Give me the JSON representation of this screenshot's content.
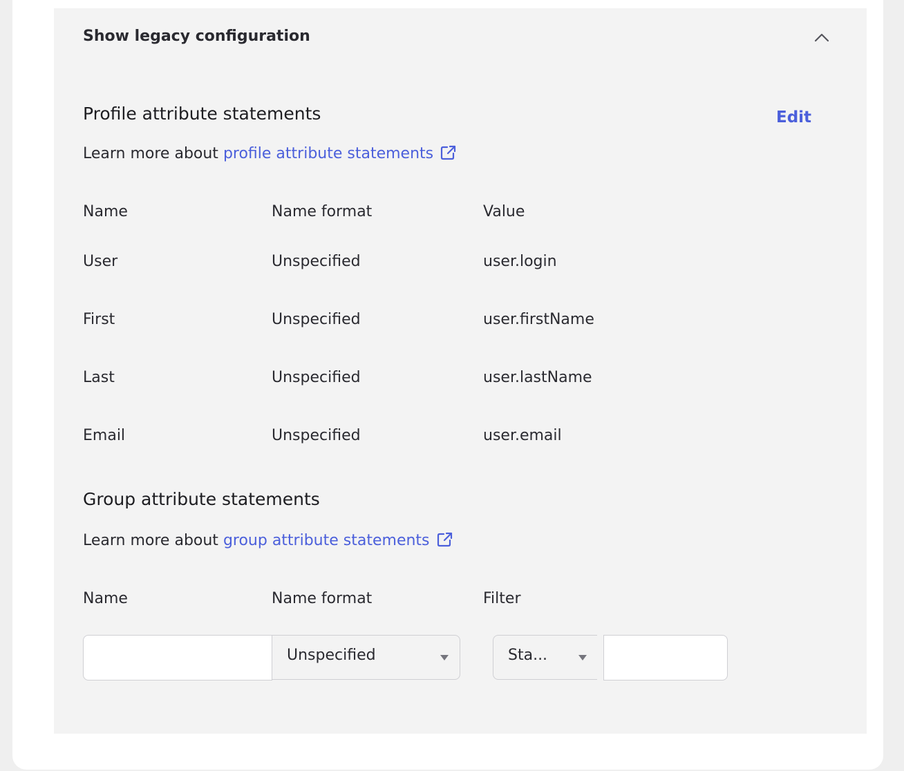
{
  "legacy": {
    "toggle_label": "Show legacy configuration"
  },
  "profile": {
    "title": "Profile attribute statements",
    "edit_label": "Edit",
    "learn_prefix": "Learn more about ",
    "learn_link": "profile attribute statements",
    "columns": [
      "Name",
      "Name format",
      "Value"
    ],
    "rows": [
      {
        "name": "User",
        "format": "Unspecified",
        "value": "user.login"
      },
      {
        "name": "First",
        "format": "Unspecified",
        "value": "user.firstName"
      },
      {
        "name": "Last",
        "format": "Unspecified",
        "value": "user.lastName"
      },
      {
        "name": "Email",
        "format": "Unspecified",
        "value": "user.email"
      }
    ]
  },
  "group": {
    "title": "Group attribute statements",
    "learn_prefix": "Learn more about ",
    "learn_link": "group attribute statements",
    "columns": [
      "Name",
      "Name format",
      "Filter"
    ],
    "name_value": "",
    "format_selected": "Unspecified",
    "filter_type_selected": "Sta...",
    "filter_value": ""
  },
  "colors": {
    "link": "#4b5fdb",
    "panel_bg": "#f3f3f3"
  }
}
